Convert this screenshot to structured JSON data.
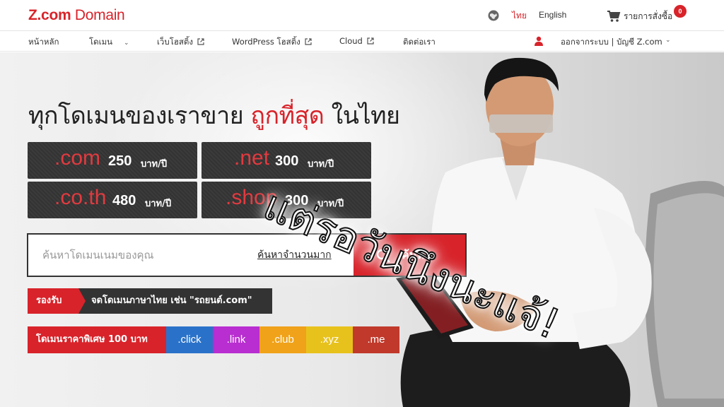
{
  "brand": {
    "logo_prefix": "Z.com",
    "logo_suffix": " Domain",
    "accent": "#d8232a"
  },
  "topbar": {
    "lang_thai": "ไทย",
    "lang_english": "English",
    "cart_label": "รายการสั่งซื้อ",
    "cart_count": "0"
  },
  "nav": {
    "items": [
      {
        "label": "หน้าหลัก"
      },
      {
        "label": "โดเมน"
      },
      {
        "label": "เว็บโฮสติ้ง"
      },
      {
        "label": "WordPress โฮสติ้ง"
      },
      {
        "label": "Cloud"
      },
      {
        "label": "ติดต่อเรา"
      }
    ],
    "account_label": "ออกจากระบบ | บัญชี Z.com"
  },
  "hero": {
    "headline_part1": "ทุกโดเมนของเราขาย ",
    "headline_highlight": "ถูกที่สุด",
    "headline_part2": " ในไทย",
    "prices": [
      {
        "tld": ".com",
        "amount": "250",
        "unit": "บาท/ปี"
      },
      {
        "tld": ".net",
        "amount": "300",
        "unit": "บาท/ปี"
      },
      {
        "tld": ".co.th",
        "amount": "480",
        "unit": "บาท/ปี"
      },
      {
        "tld": ".shop",
        "amount": "300",
        "unit": "บาท/ปี"
      }
    ],
    "overlay_text": "แต่รอวันนึงนะแจ้!"
  },
  "search": {
    "placeholder": "ค้นหาโดเมนเนมของคุณ",
    "bulk_link": "ค้นหาจำนวนมาก",
    "button_label": "ค้นหา"
  },
  "support": {
    "tag": "รองรับ",
    "message": "จดโดเมนภาษาไทย เช่น \"รถยนต์.com\""
  },
  "special": {
    "label": "โดเมนราคาพิเศษ 100 บาท",
    "tlds": [
      {
        "name": ".click",
        "color": "#2a72c9"
      },
      {
        "name": ".link",
        "color": "#b82ed0"
      },
      {
        "name": ".club",
        "color": "#f0a21a"
      },
      {
        "name": ".xyz",
        "color": "#e8c21c"
      },
      {
        "name": ".me",
        "color": "#c0392b"
      }
    ]
  }
}
